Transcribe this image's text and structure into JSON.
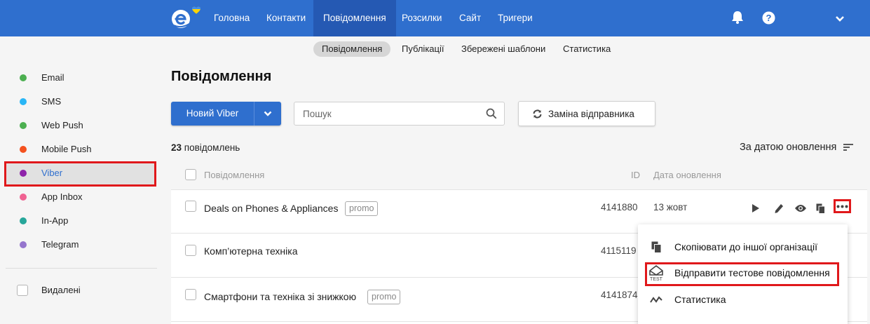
{
  "topnav": {
    "items": [
      "Головна",
      "Контакти",
      "Повідомлення",
      "Розсилки",
      "Сайт",
      "Тригери"
    ],
    "active_index": 2,
    "brand_color": "#2f6fce"
  },
  "subnav": {
    "items": [
      "Повідомлення",
      "Публікації",
      "Збережені шаблони",
      "Статистика"
    ],
    "active_index": 0
  },
  "sidebar": {
    "channels": [
      {
        "label": "Email",
        "color": "#4caf50"
      },
      {
        "label": "SMS",
        "color": "#29b6f6"
      },
      {
        "label": "Web Push",
        "color": "#4caf50"
      },
      {
        "label": "Mobile Push",
        "color": "#f4511e"
      },
      {
        "label": "Viber",
        "color": "#8e24aa",
        "active": true
      },
      {
        "label": "App Inbox",
        "color": "#f06292"
      },
      {
        "label": "In-App",
        "color": "#26a69a"
      },
      {
        "label": "Telegram",
        "color": "#9575cd"
      }
    ],
    "deleted_label": "Видалені"
  },
  "main": {
    "title": "Повідомлення",
    "new_button_label": "Новий Viber",
    "search_placeholder": "Пошук",
    "change_sender_label": "Заміна відправника",
    "count_number": "23",
    "count_text": "повідомлень",
    "sort_label": "За датою оновлення",
    "columns": {
      "name": "Повідомлення",
      "id": "ID",
      "date": "Дата оновлення"
    },
    "rows": [
      {
        "name": "Deals on Phones & Appliances",
        "tag": "promo",
        "id": "4141880",
        "date": "13 жовт"
      },
      {
        "name": "Комп’ютерна техніка",
        "tag": "",
        "id": "4115119",
        "date": ""
      },
      {
        "name": "Смартфони та техніка зі знижкою",
        "tag": "promo",
        "id": "4141874",
        "date": ""
      }
    ]
  },
  "context_menu": {
    "items": [
      {
        "label": "Скопіювати до іншої організації",
        "icon": "copy-icon"
      },
      {
        "label": "Відправити тестове повідомлення",
        "icon": "test-mail-icon"
      },
      {
        "label": "Статистика",
        "icon": "stats-icon"
      }
    ]
  }
}
